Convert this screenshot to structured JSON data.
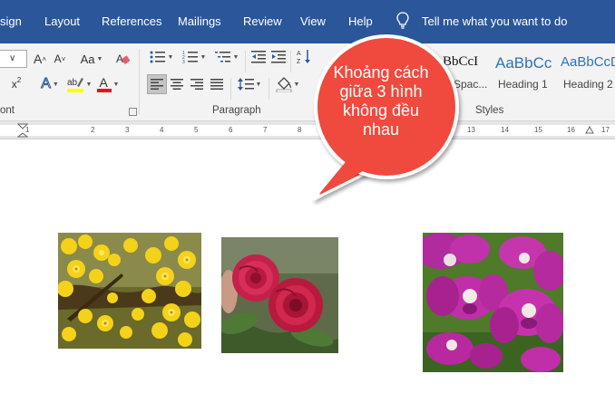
{
  "menu": {
    "tabs": [
      "sign",
      "Layout",
      "References",
      "Mailings",
      "Review",
      "View",
      "Help"
    ],
    "tell_me": "Tell me what you want to do"
  },
  "ribbon": {
    "font_group_label": "ont",
    "paragraph_group_label": "Paragraph",
    "styles_group_label": "Styles",
    "font_buttons": {
      "grow_font": "A",
      "shrink_font": "A",
      "change_case": "Aa",
      "subscript": "x",
      "superscript": "x²",
      "text_effects": "A",
      "font_color": "A"
    },
    "styles": [
      {
        "preview": "BbCcI",
        "name": "Spac..."
      },
      {
        "preview": "AaBbCc",
        "name": "Heading 1"
      },
      {
        "preview": "AaBbCcD",
        "name": "Heading 2"
      }
    ]
  },
  "ruler": {
    "numbers_left": [
      "1",
      "2",
      "3",
      "4",
      "5",
      "6",
      "7",
      "8"
    ],
    "numbers_right": [
      "13",
      "14",
      "15",
      "16",
      "17"
    ]
  },
  "callout": {
    "lines": [
      "Khoảng cách",
      "giữa 3 hình",
      "không đều",
      "nhau"
    ],
    "color": "#f04a3e"
  },
  "photos": [
    {
      "subject": "yellow-flowers"
    },
    {
      "subject": "red-roses"
    },
    {
      "subject": "magenta-orchids"
    }
  ],
  "colors": {
    "title_bar": "#2b579a",
    "ribbon": "#f3f3f3",
    "highlight_yellow": "#ffff00",
    "font_red": "#e81123"
  }
}
